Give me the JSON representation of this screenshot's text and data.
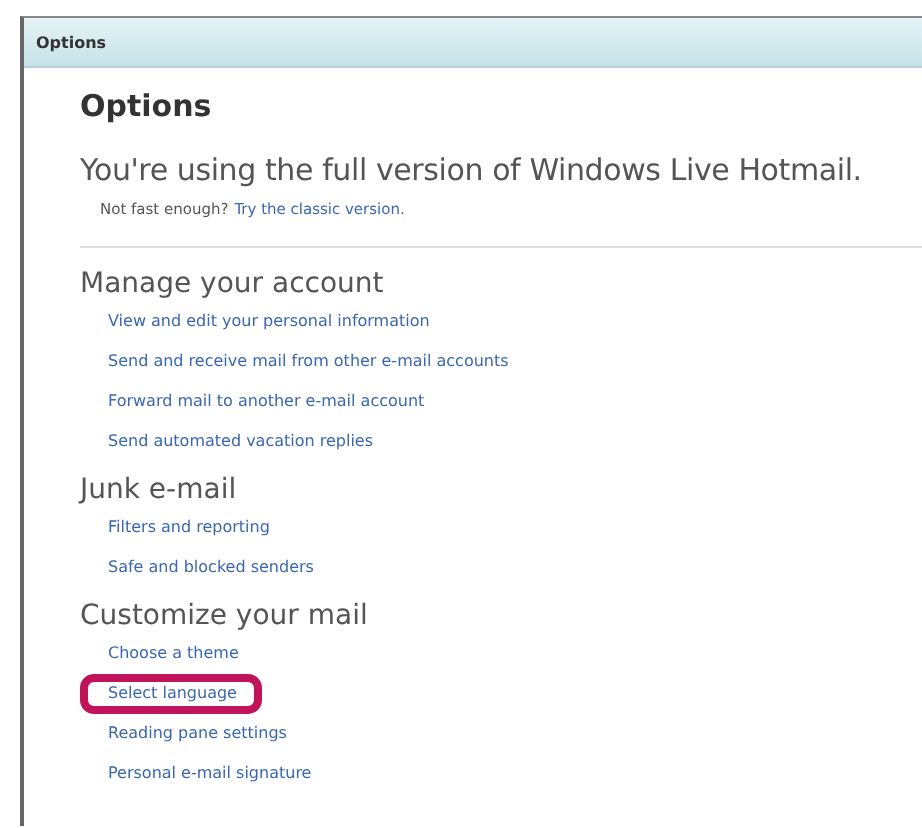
{
  "window": {
    "title": "Options"
  },
  "heading": "Options",
  "intro": {
    "text": "You're using the full version of Windows Live Hotmail.",
    "note": "Not fast enough?",
    "link": "Try the classic version."
  },
  "sections": [
    {
      "title": "Manage your account",
      "links": [
        {
          "label": "View and edit your personal information",
          "highlighted": false
        },
        {
          "label": "Send and receive mail from other e-mail accounts",
          "highlighted": false
        },
        {
          "label": "Forward mail to another e-mail account",
          "highlighted": false
        },
        {
          "label": "Send automated vacation replies",
          "highlighted": false
        }
      ]
    },
    {
      "title": "Junk e-mail",
      "links": [
        {
          "label": "Filters and reporting",
          "highlighted": false
        },
        {
          "label": "Safe and blocked senders",
          "highlighted": false
        }
      ]
    },
    {
      "title": "Customize your mail",
      "links": [
        {
          "label": "Choose a theme",
          "highlighted": false
        },
        {
          "label": "Select language",
          "highlighted": true
        },
        {
          "label": "Reading pane settings",
          "highlighted": false
        },
        {
          "label": "Personal e-mail signature",
          "highlighted": false
        }
      ]
    }
  ]
}
